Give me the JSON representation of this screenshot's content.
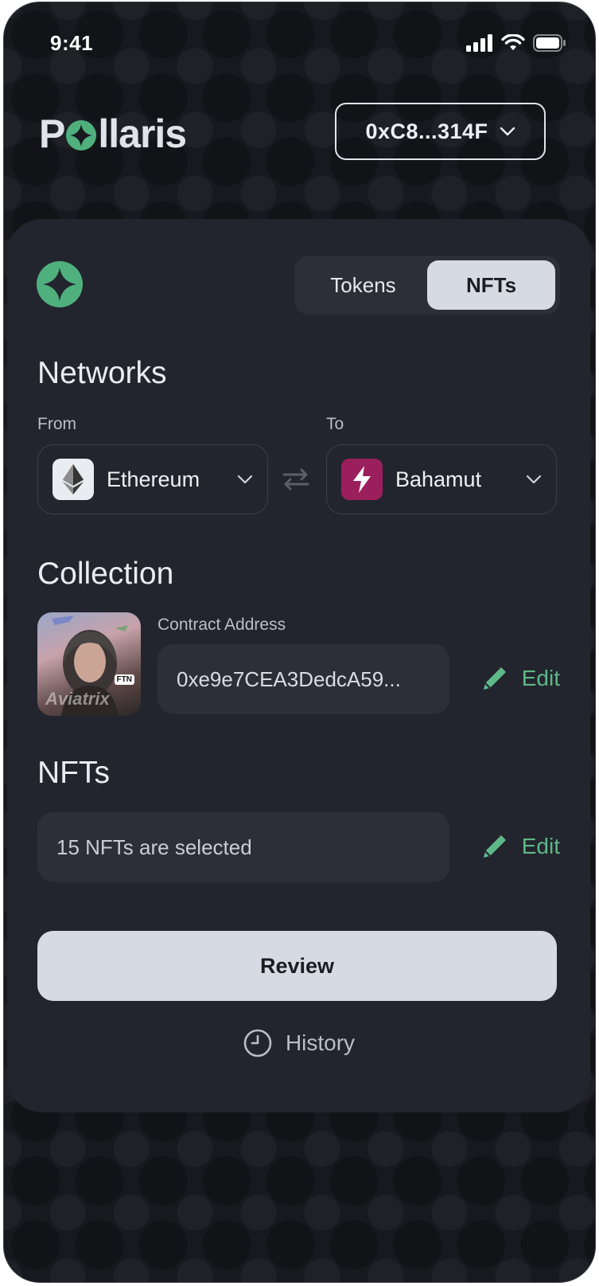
{
  "status_bar": {
    "time": "9:41"
  },
  "header": {
    "logo_text_left": "P",
    "logo_text_right": "llaris",
    "wallet_address": "0xC8...314F"
  },
  "tabs": [
    {
      "label": "Tokens",
      "active": false
    },
    {
      "label": "NFTs",
      "active": true
    }
  ],
  "networks": {
    "title": "Networks",
    "from_label": "From",
    "to_label": "To",
    "from_network": "Ethereum",
    "to_network": "Bahamut"
  },
  "collection": {
    "title": "Collection",
    "contract_label": "Contract Address",
    "contract_address": "0xe9e7CEA3DedcA59...",
    "thumbnail_caption": "Aviatrix",
    "thumbnail_badge": "FTN",
    "edit_label": "Edit"
  },
  "nfts": {
    "title": "NFTs",
    "selection_text": "15 NFTs are selected",
    "edit_label": "Edit"
  },
  "actions": {
    "review_label": "Review",
    "history_label": "History"
  },
  "colors": {
    "accent_green": "#5fb889",
    "brand_green": "#4fb07e",
    "bahamut_magenta": "#9b1f5c",
    "card_bg": "#22252d"
  }
}
